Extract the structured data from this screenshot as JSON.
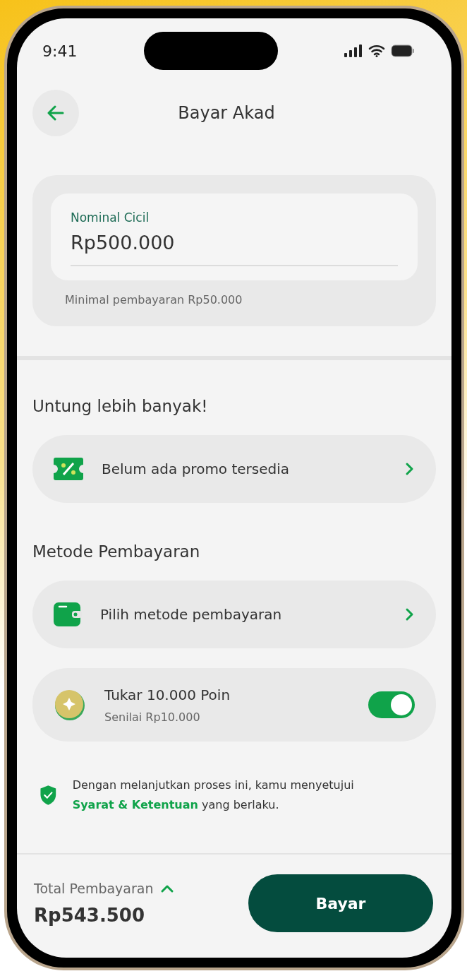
{
  "status_bar": {
    "time": "9:41"
  },
  "header": {
    "title": "Bayar Akad"
  },
  "amount_card": {
    "label": "Nominal Cicil",
    "value": "Rp500.000",
    "hint": "Minimal pembayaran Rp50.000"
  },
  "promo_section": {
    "title": "Untung lebih banyak!",
    "rows": [
      {
        "kind": "promo",
        "text": "Belum ada promo tersedia"
      }
    ]
  },
  "payment_section": {
    "title": "Metode Pembayaran",
    "rows": [
      {
        "kind": "method",
        "text": "Pilih metode pembayaran"
      },
      {
        "kind": "points",
        "text": "Tukar 10.000 Poin",
        "subtitle": "Senilai Rp10.000",
        "on": true
      }
    ]
  },
  "terms": {
    "before": "Dengan melanjutkan proses ini, kamu menyetujui ",
    "link": "Syarat & Ketentuan",
    "after": " yang berlaku."
  },
  "footer": {
    "total_label": "Total Pembayaran",
    "total_value": "Rp543.500",
    "button": "Bayar"
  }
}
